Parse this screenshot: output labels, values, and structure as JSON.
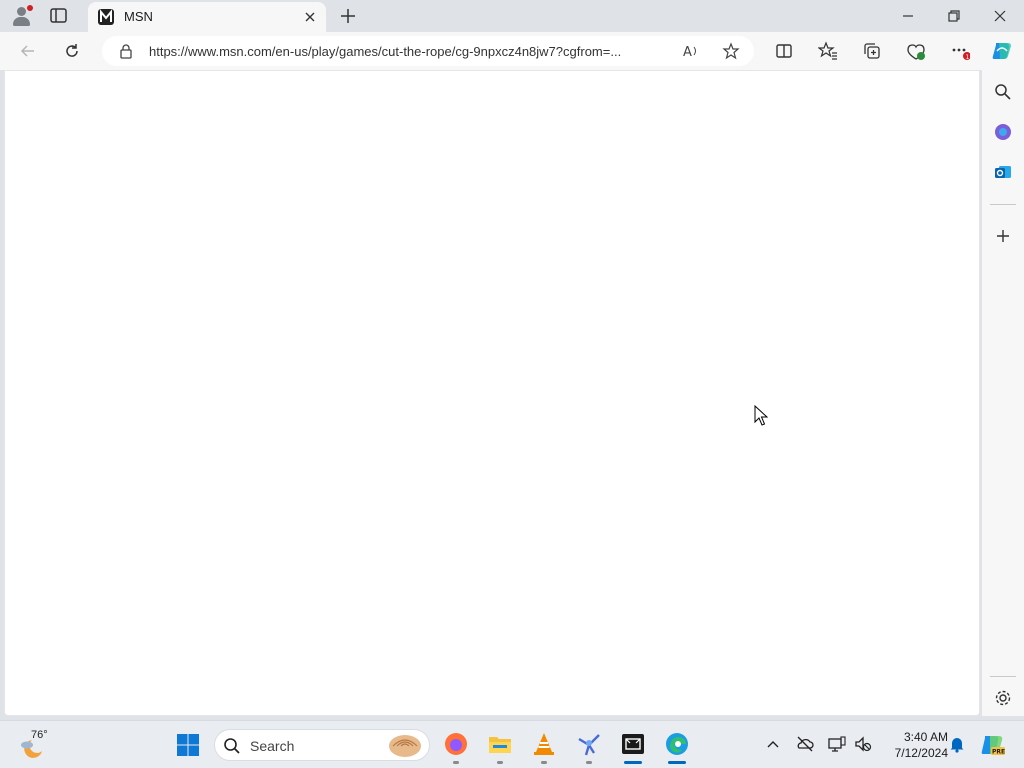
{
  "browser": {
    "tab": {
      "title": "MSN"
    },
    "address": {
      "url": "https://www.msn.com/en-us/play/games/cut-the-rope/cg-9npxcz4n8jw7?cgfrom=..."
    }
  },
  "taskbar": {
    "weather": {
      "temperature": "76°"
    },
    "search": {
      "label": "Search"
    },
    "clock": {
      "time": "3:40 AM",
      "date": "7/12/2024"
    }
  },
  "colors": {
    "accent": "#0067c0",
    "notification": "#d21f26",
    "chrome_bg": "#dfe3e8"
  }
}
